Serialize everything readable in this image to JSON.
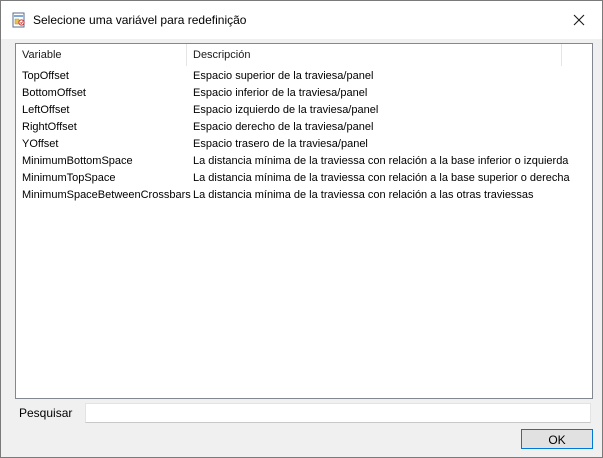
{
  "window": {
    "title": "Selecione uma variável para redefinição",
    "icon": "app-document-icon",
    "close_icon": "close-icon"
  },
  "list": {
    "columns": [
      "Variable",
      "Descripción"
    ],
    "rows": [
      {
        "variable": "TopOffset",
        "description": "Espacio superior de la traviesa/panel"
      },
      {
        "variable": "BottomOffset",
        "description": "Espacio inferior de la traviesa/panel"
      },
      {
        "variable": "LeftOffset",
        "description": "Espacio izquierdo de la traviesa/panel"
      },
      {
        "variable": "RightOffset",
        "description": "Espacio derecho de la traviesa/panel"
      },
      {
        "variable": "YOffset",
        "description": "Espacio trasero de la traviesa/panel"
      },
      {
        "variable": "MinimumBottomSpace",
        "description": "La distancia mínima de la traviessa con relación a la base inferior o izquierda"
      },
      {
        "variable": "MinimumTopSpace",
        "description": "La distancia mínima de la traviessa con relación a la base superior o derecha"
      },
      {
        "variable": "MinimumSpaceBetweenCrossbars",
        "description": "La distancia mínima de la traviessa con relación a las otras traviessas"
      }
    ]
  },
  "search": {
    "label": "Pesquisar",
    "value": ""
  },
  "buttons": {
    "ok_label": "OK"
  },
  "colors": {
    "accent": "#0078d7",
    "window_bg": "#f0f0f0"
  }
}
